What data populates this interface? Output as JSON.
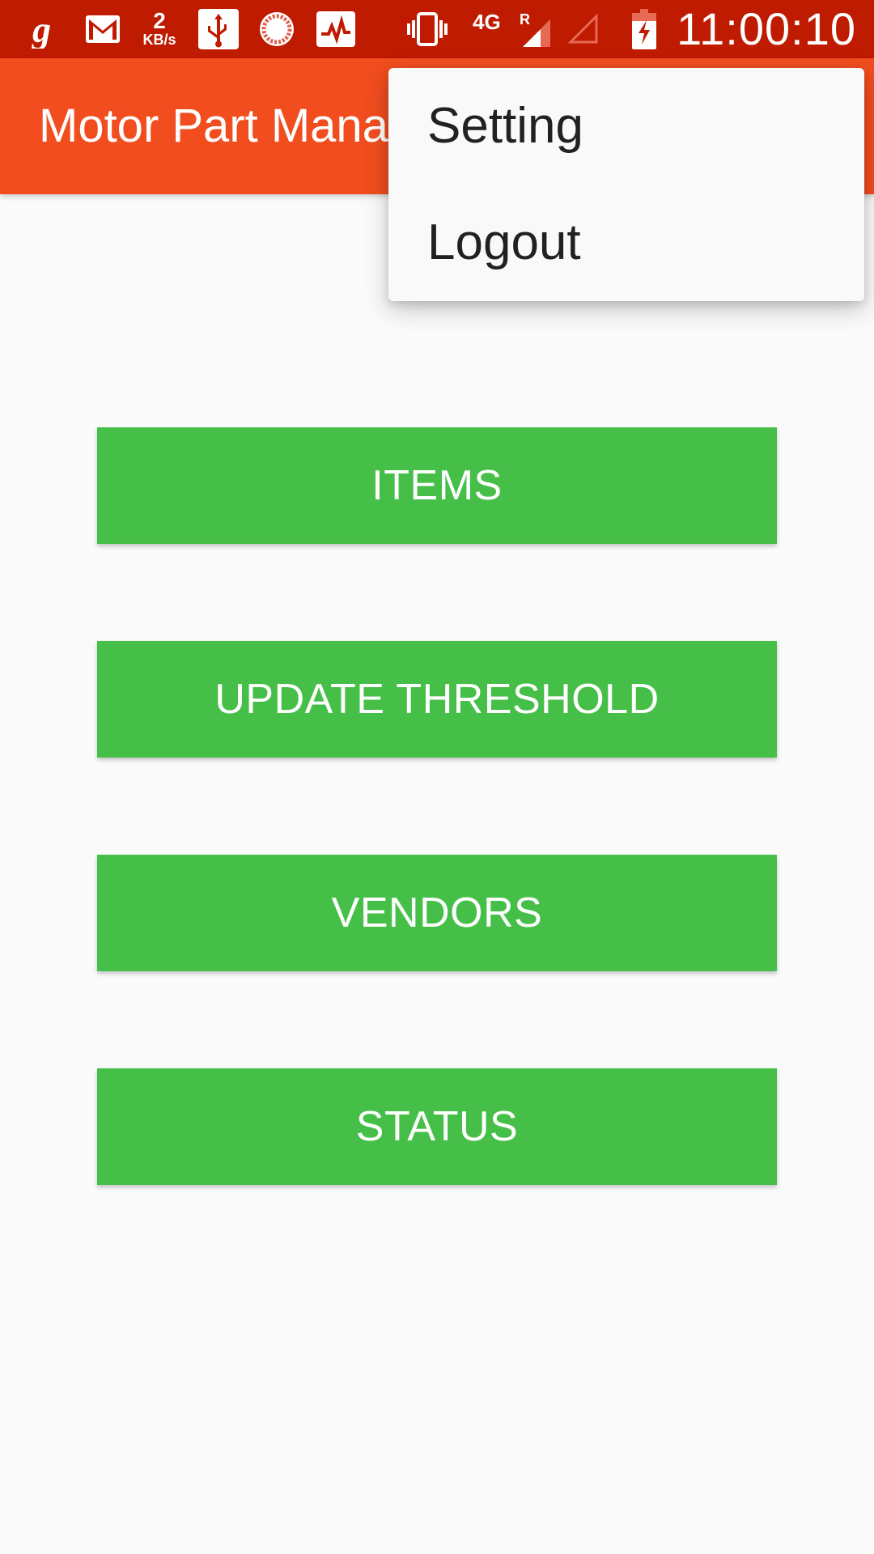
{
  "status_bar": {
    "time": "11:00:10",
    "network_speed_value": "2",
    "network_speed_unit": "KB/s",
    "network_type": "4G",
    "roaming": "R",
    "icons": [
      "g-app-icon",
      "gmail-icon",
      "network-speed-icon",
      "usb-icon",
      "sync-icon",
      "activity-icon",
      "vibrate-icon",
      "signal-4g-icon",
      "signal-empty-icon",
      "battery-charging-icon"
    ]
  },
  "app_bar": {
    "title": "Motor Part Management"
  },
  "overflow_menu": {
    "items": [
      {
        "label": "Setting"
      },
      {
        "label": "Logout"
      }
    ]
  },
  "buttons": [
    {
      "label": "ITEMS"
    },
    {
      "label": "UPDATE THRESHOLD"
    },
    {
      "label": "VENDORS"
    },
    {
      "label": "STATUS"
    }
  ],
  "colors": {
    "status_bar": "#bf1b00",
    "app_bar": "#f14d1f",
    "button": "#46bf48",
    "background": "#fafafa",
    "menu_bg": "#f9f9f9"
  }
}
